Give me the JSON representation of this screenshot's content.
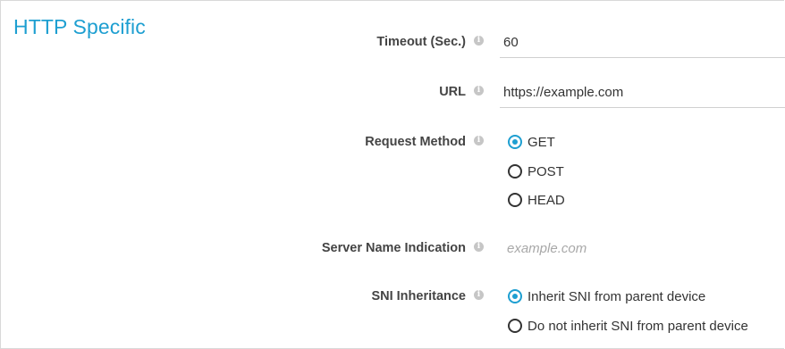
{
  "section": {
    "title": "HTTP Specific"
  },
  "fields": {
    "timeout": {
      "label": "Timeout (Sec.)",
      "value": "60"
    },
    "url": {
      "label": "URL",
      "value": "https://example.com"
    },
    "request_method": {
      "label": "Request Method",
      "options": [
        "GET",
        "POST",
        "HEAD"
      ],
      "selected": "GET"
    },
    "sni": {
      "label": "Server Name Indication",
      "placeholder": "example.com"
    },
    "sni_inheritance": {
      "label": "SNI Inheritance",
      "options": [
        "Inherit SNI from parent device",
        "Do not inherit SNI from parent device"
      ],
      "selected": "Inherit SNI from parent device"
    }
  },
  "icons": {
    "info": "info-icon"
  },
  "colors": {
    "accent": "#1e9fd1",
    "label": "#444444",
    "info_icon": "#c6c6c6"
  }
}
